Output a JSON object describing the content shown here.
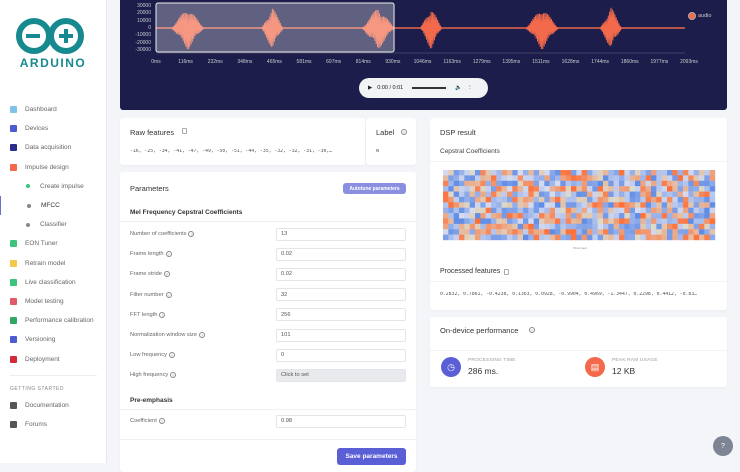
{
  "brand": {
    "name": "ARDUINO",
    "color": "#178a8f"
  },
  "sidebar": {
    "items": [
      {
        "label": "Dashboard",
        "color": "#7fc4e8"
      },
      {
        "label": "Devices",
        "color": "#4c5bd4"
      },
      {
        "label": "Data acquisition",
        "color": "#2b2d8c"
      },
      {
        "label": "Impulse design",
        "color": "#f26a4b"
      }
    ],
    "sub_items": [
      {
        "label": "Create impulse",
        "color": "#3cc47c"
      },
      {
        "label": "MFCC",
        "color": "#888"
      },
      {
        "label": "Classifier",
        "color": "#888"
      }
    ],
    "items2": [
      {
        "label": "EON Tuner",
        "color": "#3cc47c"
      },
      {
        "label": "Retrain model",
        "color": "#f2c94c"
      },
      {
        "label": "Live classification",
        "color": "#3cc47c"
      },
      {
        "label": "Model testing",
        "color": "#e05a6a"
      },
      {
        "label": "Performance calibration",
        "color": "#2fa866"
      },
      {
        "label": "Versioning",
        "color": "#4c5bd4"
      },
      {
        "label": "Deployment",
        "color": "#d42b3a"
      }
    ],
    "section_heading": "GETTING STARTED",
    "help_items": [
      {
        "label": "Documentation",
        "color": "#555"
      },
      {
        "label": "Forums",
        "color": "#555"
      }
    ]
  },
  "waveform": {
    "y_ticks": [
      "30000",
      "20000",
      "10000",
      "0",
      "-10000",
      "-20000",
      "-30000"
    ],
    "x_ticks": [
      "0ms",
      "116ms",
      "232ms",
      "348ms",
      "465ms",
      "581ms",
      "697ms",
      "814ms",
      "930ms",
      "1046ms",
      "1163ms",
      "1279ms",
      "1395ms",
      "1511ms",
      "1628ms",
      "1744ms",
      "1860ms",
      "1977ms",
      "2093ms"
    ],
    "legend": "audio",
    "color": "#f26a4b",
    "window_fraction": 0.45
  },
  "player": {
    "time": "0:00 / 0:01"
  },
  "raw_features": {
    "title": "Raw features",
    "values": "-16, -25, -34, -41, -47, -49, -50, -51, -44, -35, -32, -32, -31, -30,…"
  },
  "label": {
    "title": "Label",
    "value": "N"
  },
  "parameters": {
    "title": "Parameters",
    "autotune": "Autotune parameters",
    "mfcc_heading": "Mel Frequency Cepstral Coefficients",
    "fields": [
      {
        "label": "Number of coefficients",
        "value": "13"
      },
      {
        "label": "Frame length",
        "value": "0.02"
      },
      {
        "label": "Frame stride",
        "value": "0.02"
      },
      {
        "label": "Filter number",
        "value": "32"
      },
      {
        "label": "FFT length",
        "value": "256"
      },
      {
        "label": "Normalization window size",
        "value": "101"
      },
      {
        "label": "Low frequency",
        "value": "0"
      },
      {
        "label": "High frequency",
        "value": "Click to set"
      }
    ],
    "pre_heading": "Pre-emphasis",
    "coef": {
      "label": "Coefficient",
      "value": "0.98"
    },
    "save": "Save parameters"
  },
  "dsp": {
    "title": "DSP result",
    "chart_title": "Cepstral Coefficients",
    "xlabel": "Time (sec)",
    "processed_title": "Processed features",
    "processed": "0.2832, 0.7861, -0.4238, 0.1363, 0.0928, -0.9904, 0.4969, -1.3447, 0.2298, 0.4412, -0.83…"
  },
  "performance": {
    "title": "On-device performance",
    "processing_label": "PROCESSING TIME",
    "processing_value": "286 ms.",
    "ram_label": "PEAK RAM USAGE",
    "ram_value": "12 KB"
  },
  "accent": "#6a6fd8"
}
